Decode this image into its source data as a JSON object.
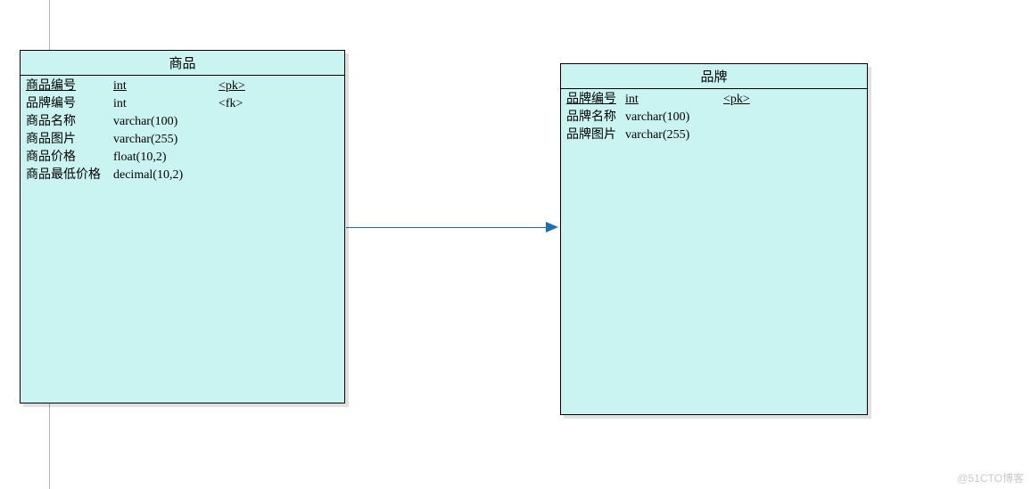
{
  "entities": [
    {
      "id": "product",
      "title": "商品",
      "columns": [
        {
          "name": "商品编号",
          "type": "int",
          "key": "<pk>",
          "underline": true
        },
        {
          "name": "品牌编号",
          "type": "int",
          "key": "<fk>",
          "underline": false
        },
        {
          "name": "商品名称",
          "type": "varchar(100)",
          "key": "",
          "underline": false
        },
        {
          "name": "商品图片",
          "type": "varchar(255)",
          "key": "",
          "underline": false
        },
        {
          "name": "商品价格",
          "type": "float(10,2)",
          "key": "",
          "underline": false
        },
        {
          "name": "商品最低价格",
          "type": "decimal(10,2)",
          "key": "",
          "underline": false
        }
      ]
    },
    {
      "id": "brand",
      "title": "品牌",
      "columns": [
        {
          "name": "品牌编号",
          "type": "int",
          "key": "<pk>",
          "underline": true
        },
        {
          "name": "品牌名称",
          "type": "varchar(100)",
          "key": "",
          "underline": false
        },
        {
          "name": "品牌图片",
          "type": "varchar(255)",
          "key": "",
          "underline": false
        }
      ]
    }
  ],
  "relationship": {
    "from": "product",
    "to": "brand",
    "via_fk": "品牌编号"
  },
  "watermark": "@51CTO博客"
}
